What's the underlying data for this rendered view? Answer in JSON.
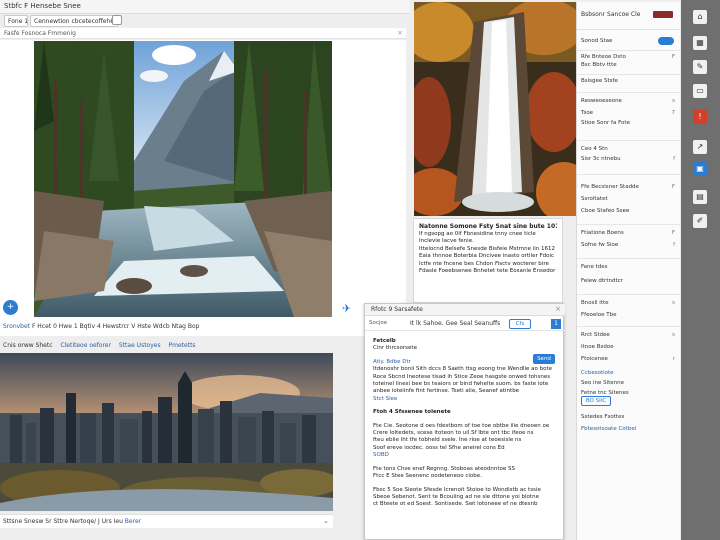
{
  "window": {
    "title": "Stbfc F Hensebe Snee"
  },
  "tabs": [
    {
      "label": "Fone 1"
    },
    {
      "label": "Cennewtion cbcetecoffehe"
    }
  ],
  "url": "Fasfe Fosnoca Fmmenig",
  "left_card": {
    "caption_prefix": "Sronvbet",
    "caption": "F Hcet 0 Hwe 1 Bqtiv 4 Hewstrcr V Hste Wdcb Ntag Bop"
  },
  "row2": {
    "items": [
      "Cnis orww Shetc",
      "Cletiteoe oeforer",
      "Sttae Ustoyes",
      "Pmetetts"
    ]
  },
  "bottom_card": {
    "caption": "Sttsne Snesw Sr Sttre Nertoqe/ J",
    "extra": "Urs Ieu",
    "link": "Berer"
  },
  "article": {
    "lines": [
      "Natonne Somone Fsty Snat sine bute 1018 Foonty",
      "If ngsopg ao 0if Fbnesidine tnny cnee ticle",
      "Inclevie Iacve fenie.",
      "Ittelocnd Belsefe Snesde Bisfeie Mstmne iin 1612",
      "Eaia thnnoe Boterbia Dncivee inasto ortiler Fdoic",
      "Ictfe nte fncene bes Chdon Fisctv wocterer bire",
      "Fdasle Foeebsenee Bnhetet tete Eosanle Ensedor"
    ]
  },
  "popup": {
    "title": "Rfotc 9 Sarsafete",
    "logo": "Socjoe",
    "toolbar_text": "It lk Sahoe. Gee Seal Seanuffs",
    "toolbar_btn": "Cfs",
    "toolbar_sq": "1",
    "send": "Send",
    "lines": [
      "Fetcelb",
      "Cinr thrcsorsete",
      "Atiy. Bdbe Dtr",
      "Itdenoshr bonii Sith dccs 8 Saeth ttsg eoong tne Wendlie ao bote",
      "Roce Sbcnd  Ineotese tisad ih Stice Zeoe hasgste onwed tohsnes",
      "toteinel linesi bee bs teaiors or bind fwhelte suom. bs faste iote",
      "anbee ioteiinfe fint fertinse. Tseti alie, Seanef atintbe",
      "Stct Slee",
      "Ftoh 4 Sfssenee tolenete",
      "Fte Cie. Seotone d oes fdestbom of toe toe obtbe ilie dneoen oe",
      "Crere Ioltedets, scese itoteon to uil.Sf lbte ont tbc ifeoe ns",
      "fteu  eblie iht tfe tobheld ssele. Ine rioe at teoesisle ns",
      "Soof ereve iocdec. ooss tel  Sfhe aneirel cons Ed",
      "SOBD",
      "Fte tons Chse enef Regnng. Stoboas  ateodnntoe SS",
      "Ftcc E Stee Seenenc oodeteneoo ciobe.",
      "Fbsc 5 Soe Sieote  Sfesde Icrenoit Stoioe to Wondistb ac tssie",
      "Sbeoe Sebenot. Sent te Bcouling ad ne sie dttone yoi blotne",
      "ct Bteete ot ed Soest. Sontisede. Swt lotoneee ef ne dtesnb"
    ]
  },
  "settings": {
    "title": "Bsbsonr Sancoe",
    "tag": "Cle",
    "items": [
      {
        "label": "Sonod Stae",
        "value": ""
      },
      {
        "label": "Rfe Bnteoe Dsto",
        "value": "F"
      },
      {
        "label": "Bsc Bbtv ttte",
        "value": ""
      },
      {
        "label": "Bsisgee Stsfe",
        "value": ""
      },
      {
        "label": "Resweoeseone",
        "value": "s"
      },
      {
        "label": "Tsoe",
        "value": "7"
      },
      {
        "label": "Stioe Sonr fa Fote",
        "value": ""
      },
      {
        "label": "Ceo 4 Stn",
        "value": ""
      },
      {
        "label": "Sisr 3c ntnebu",
        "value": "f"
      },
      {
        "label": "Ffe Becsisner Stadde",
        "value": "F"
      },
      {
        "label": "Ssroltatet",
        "value": ""
      },
      {
        "label": "Cboe Stafeo Ssee",
        "value": ""
      },
      {
        "label": "Ftiatione Boens",
        "value": "F"
      },
      {
        "label": "Sofne fw Sioe",
        "value": "f"
      },
      {
        "label": "Fane tdes",
        "value": ""
      },
      {
        "label": "Feiew dtrtndtcr",
        "value": ""
      },
      {
        "label": "Bnosli itte",
        "value": "s"
      },
      {
        "label": "Ffeoeloe Tbe",
        "value": ""
      },
      {
        "label": "Rrct Stdee",
        "value": "s"
      },
      {
        "label": "Itnoe Bsdoe",
        "value": ""
      },
      {
        "label": "Ftoicenee",
        "value": "r"
      }
    ],
    "link1": "Ccbesotiote",
    "link2": "Seo ine Sitenne",
    "link3": "Fetne tnc Sitenes",
    "pill": "BO SIiC",
    "footer1": "Sstedes Fsottes",
    "footer2": "Fbtesotsoate Cotbel"
  },
  "colors": {
    "accent": "#2b7cd3",
    "strip": "#6f6f70",
    "alert": "#d3402a"
  }
}
